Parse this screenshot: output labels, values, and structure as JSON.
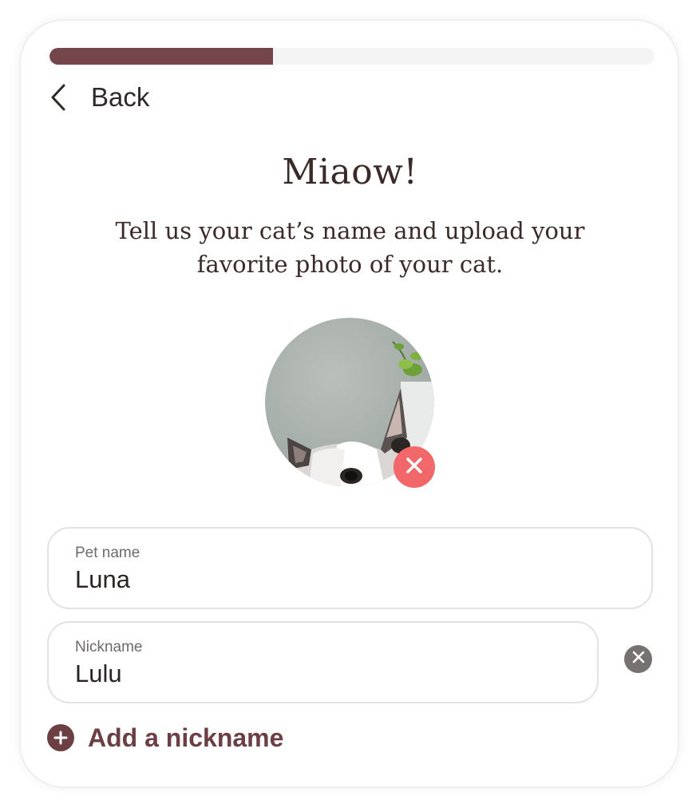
{
  "progress": {
    "value": 0.37
  },
  "nav": {
    "back_label": "Back",
    "back_icon": "chevron-left-icon"
  },
  "header": {
    "title": "Miaow!",
    "subtitle": "Tell us your cat’s name and upload your favorite photo of your cat."
  },
  "photo": {
    "remove_icon": "close-icon"
  },
  "form": {
    "pet_name": {
      "label": "Pet name",
      "value": "Luna"
    },
    "nickname": {
      "label": "Nickname",
      "value": "Lulu",
      "clear_icon": "close-circle-icon"
    },
    "add_nickname_label": "Add a nickname",
    "add_icon": "plus-circle-icon"
  },
  "colors": {
    "accent": "#74454a",
    "progress_track": "#f5f4f4",
    "remove_red": "#f2676a",
    "text_dark": "#3a2a2a"
  }
}
